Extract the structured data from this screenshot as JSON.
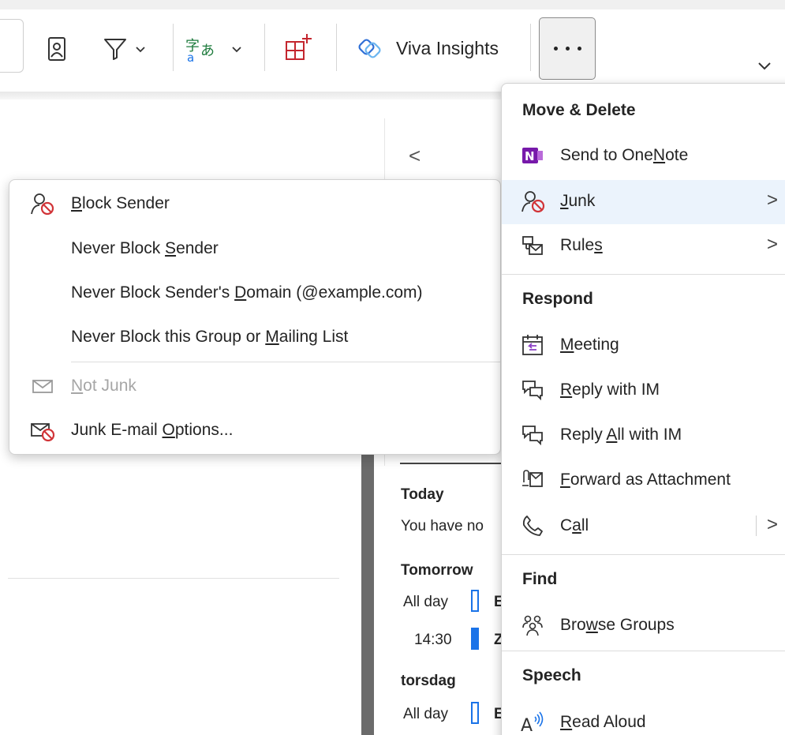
{
  "ribbon": {
    "viva_label": "Viva Insights",
    "icons": [
      "address-book-icon",
      "filter-icon",
      "translate-icon",
      "add-apps-icon",
      "viva-insights-icon",
      "more-options-icon",
      "collapse-ribbon-icon"
    ]
  },
  "reading_pane": {
    "back_chevron": "<"
  },
  "calendar_peek": {
    "today_heading": "Today",
    "today_message": "You have no",
    "tomorrow_heading": "Tomorrow",
    "tomorrow_event1_time": "All day",
    "tomorrow_event1_title": "E",
    "tomorrow_event2_time": "14:30",
    "tomorrow_event2_title": "Z",
    "thursday_heading": "torsdag",
    "thursday_event1_time": "All day",
    "thursday_event1_title": "E"
  },
  "junk_submenu": {
    "items": [
      {
        "pre": "",
        "acc": "B",
        "post": "lock Sender",
        "icon": "block-sender-icon",
        "enabled": true
      },
      {
        "pre": "Never Block ",
        "acc": "S",
        "post": "ender",
        "icon": "",
        "enabled": true
      },
      {
        "pre": "Never Block Sender's ",
        "acc": "D",
        "post": "omain (@example.com)",
        "icon": "",
        "enabled": true
      },
      {
        "pre": "Never Block this Group or ",
        "acc": "M",
        "post": "ailing List",
        "icon": "",
        "enabled": true
      },
      {
        "pre": "",
        "acc": "N",
        "post": "ot Junk",
        "icon": "envelope-icon",
        "enabled": false
      },
      {
        "pre": "Junk E-mail ",
        "acc": "O",
        "post": "ptions...",
        "icon": "junk-options-icon",
        "enabled": true
      }
    ]
  },
  "more_menu": {
    "sections": {
      "move_delete": "Move & Delete",
      "respond": "Respond",
      "find": "Find",
      "speech": "Speech"
    },
    "items": {
      "send_onenote": {
        "pre": "Send to One",
        "acc": "N",
        "post": "ote"
      },
      "junk": {
        "pre": "",
        "acc": "J",
        "post": "unk"
      },
      "rules": {
        "pre": "Rule",
        "acc": "s",
        "post": ""
      },
      "meeting": {
        "pre": "",
        "acc": "M",
        "post": "eeting"
      },
      "reply_im": {
        "pre": "",
        "acc": "R",
        "post": "eply with IM"
      },
      "reply_all_im": {
        "pre": "Reply ",
        "acc": "A",
        "post": "ll with IM"
      },
      "forward_attachment": {
        "pre": "",
        "acc": "F",
        "post": "orward as Attachment"
      },
      "call": {
        "pre": "C",
        "acc": "a",
        "post": "ll"
      },
      "browse_groups": {
        "pre": "Bro",
        "acc": "w",
        "post": "se Groups"
      },
      "read_aloud": {
        "pre": "",
        "acc": "R",
        "post": "ead Aloud"
      }
    },
    "submenu_arrow": ">"
  },
  "colors": {
    "accent": "#1a73e8",
    "onenote": "#7719aa",
    "block_red": "#d13438",
    "hover": "#ebf3fc",
    "viva": "#2f6fd6"
  }
}
